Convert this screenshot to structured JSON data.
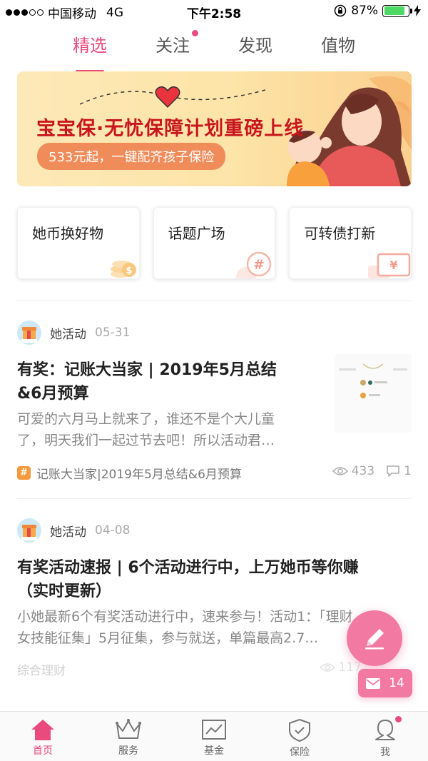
{
  "status_bar": {
    "carrier": "中国移动",
    "network": "4G",
    "time": "下午2:58",
    "battery": "87%",
    "battery_level": 0.87
  },
  "top_tabs": [
    {
      "label": "精选",
      "active": true
    },
    {
      "label": "关注",
      "active": false,
      "has_dot": true
    },
    {
      "label": "发现",
      "active": false
    },
    {
      "label": "值物",
      "active": false
    }
  ],
  "banner": {
    "title": "宝宝保·无忧保障计划重磅上线",
    "subtitle": "533元起，一键配齐孩子保险"
  },
  "quick_cards": [
    {
      "label": "她币换好物",
      "icon": "coins-icon"
    },
    {
      "label": "话题广场",
      "icon": "hashtag-bubble-icon"
    },
    {
      "label": "可转债打新",
      "icon": "yen-ticket-icon"
    }
  ],
  "posts": [
    {
      "author": "她活动",
      "date": "05-31",
      "title_line1": "有奖：记账大当家 | 2019年5月总结",
      "title_line2": "&6月预算",
      "excerpt_line1": "可爱的六月马上就来了，谁还不是个大儿童",
      "excerpt_line2": "了，明天我们一起过节去吧！所以活动君…",
      "tag": "记账大当家|2019年5月总结&6月预算",
      "views": "433",
      "comments": "1"
    },
    {
      "author": "她活动",
      "date": "04-08",
      "title_line1": "有奖活动速报 | 6个活动进行中，上万她币等你赚",
      "title_line2": "（实时更新）",
      "excerpt_line1": "小她最新6个有奖活动进行中，速来参与！活动1：「理财",
      "excerpt_line2": "女技能征集」5月征集，参与就送，单篇最高2.7…",
      "tag": "综合理财",
      "views": "117"
    }
  ],
  "floating": {
    "message_count": "14"
  },
  "bottom_nav": [
    {
      "label": "首页",
      "icon": "home-icon",
      "active": true
    },
    {
      "label": "服务",
      "icon": "crown-icon",
      "active": false
    },
    {
      "label": "基金",
      "icon": "chart-icon",
      "active": false
    },
    {
      "label": "保险",
      "icon": "shield-icon",
      "active": false
    },
    {
      "label": "我",
      "icon": "user-icon",
      "active": false,
      "has_dot": true
    }
  ],
  "colors": {
    "accent": "#e94b7e",
    "fab": "#f27aa2",
    "banner_title": "#c8161d",
    "tag_orange": "#f49a3c"
  }
}
